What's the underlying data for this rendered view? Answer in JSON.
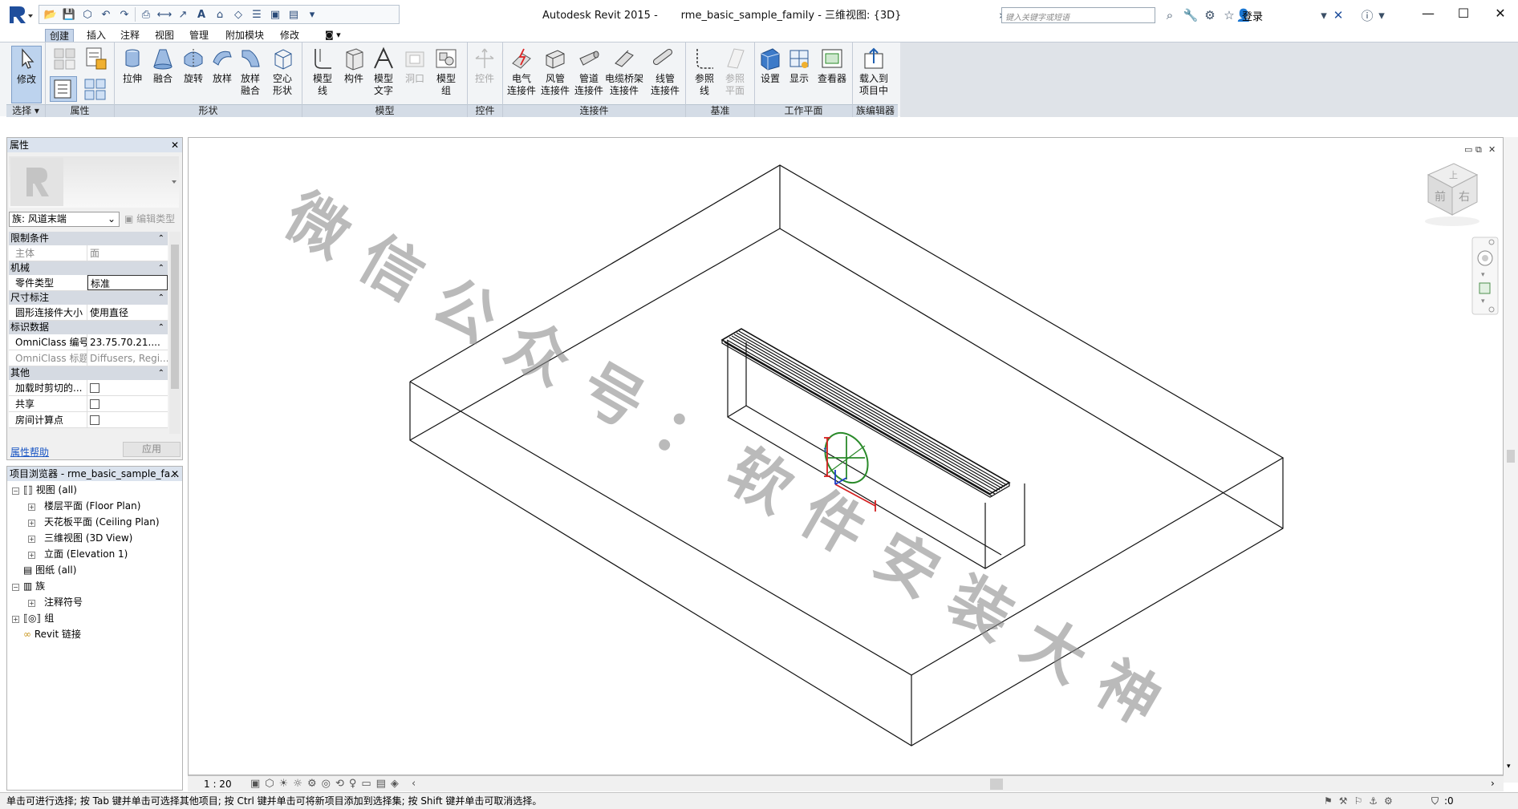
{
  "app": {
    "title": "Autodesk Revit 2015 -       rme_basic_sample_family - 三维视图: {3D}",
    "search_placeholder": "键入关键字或短语",
    "login": "登录"
  },
  "ribbon": {
    "tabs": [
      "创建",
      "插入",
      "注释",
      "视图",
      "管理",
      "附加模块",
      "修改"
    ],
    "buttons": {
      "modify": "修改",
      "extrude": "拉伸",
      "blend": "融合",
      "revolve": "旋转",
      "sweep": "放样",
      "swept_blend_1": "放样",
      "swept_blend_2": "融合",
      "void_1": "空心",
      "void_2": "形状",
      "model_line_1": "模型",
      "model_line_2": "线",
      "component": "构件",
      "model_text_1": "模型",
      "model_text_2": "文字",
      "opening": "洞口",
      "model_group_1": "模型",
      "model_group_2": "组",
      "control": "控件",
      "elec_conn_1": "电气",
      "elec_conn_2": "连接件",
      "duct_conn_1": "风管",
      "duct_conn_2": "连接件",
      "pipe_conn_1": "管道",
      "pipe_conn_2": "连接件",
      "tray_conn_1": "电缆桥架",
      "tray_conn_2": "连接件",
      "conduit_conn_1": "线管",
      "conduit_conn_2": "连接件",
      "ref_line_1": "参照",
      "ref_line_2": "线",
      "ref_plane_1": "参照",
      "ref_plane_2": "平面",
      "set": "设置",
      "show": "显示",
      "viewer": "查看器",
      "load_1": "载入到",
      "load_2": "项目中"
    },
    "panels": {
      "select": "选择",
      "properties": "属性",
      "forms": "形状",
      "model": "模型",
      "control": "控件",
      "connectors": "连接件",
      "datum": "基准",
      "work_plane": "工作平面",
      "family_editor": "族编辑器"
    }
  },
  "properties": {
    "title": "属性",
    "family_select": "族: 风道末端",
    "edit_type": "编辑类型",
    "categories": {
      "constraints": "限制条件",
      "mechanical": "机械",
      "dimensions": "尺寸标注",
      "identity": "标识数据",
      "other": "其他"
    },
    "rows": {
      "host_k": "主体",
      "host_v": "面",
      "part_k": "零件类型",
      "part_v": "标准",
      "conn_k": "圆形连接件大小",
      "conn_v": "使用直径",
      "omni_num_k": "OmniClass 编号",
      "omni_num_v": "23.75.70.21....",
      "omni_title_k": "OmniClass 标题",
      "omni_title_v": "Diffusers, Regi...",
      "cut_k": "加载时剪切的...",
      "shared_k": "共享",
      "room_k": "房间计算点"
    },
    "help": "属性帮助",
    "apply": "应用"
  },
  "browser": {
    "title": "项目浏览器 - rme_basic_sample_fa...",
    "items": {
      "views": "视图 (all)",
      "floor": "楼层平面 (Floor Plan)",
      "ceiling": "天花板平面 (Ceiling Plan)",
      "threed": "三维视图 (3D View)",
      "elev": "立面 (Elevation 1)",
      "sheets": "图纸 (all)",
      "families": "族",
      "annotation": "注释符号",
      "groups": "组",
      "links": "Revit 链接"
    }
  },
  "viewcube": {
    "top": "上",
    "front": "前",
    "right": "右"
  },
  "view_bar": {
    "scale": "1 : 20"
  },
  "status": {
    "hint": "单击可进行选择; 按 Tab 键并单击可选择其他项目; 按 Ctrl 键并单击可将新项目添加到选择集; 按 Shift 键并单击可取消选择。",
    "filter_count": ":0"
  },
  "watermark": "微信公众号：软件安装大神",
  "colors": {
    "ribbon_bg": "#f2f4f6",
    "panel_bar": "#d4dce6",
    "active_tab": "#c7d6ea",
    "link": "#1a56c4"
  }
}
